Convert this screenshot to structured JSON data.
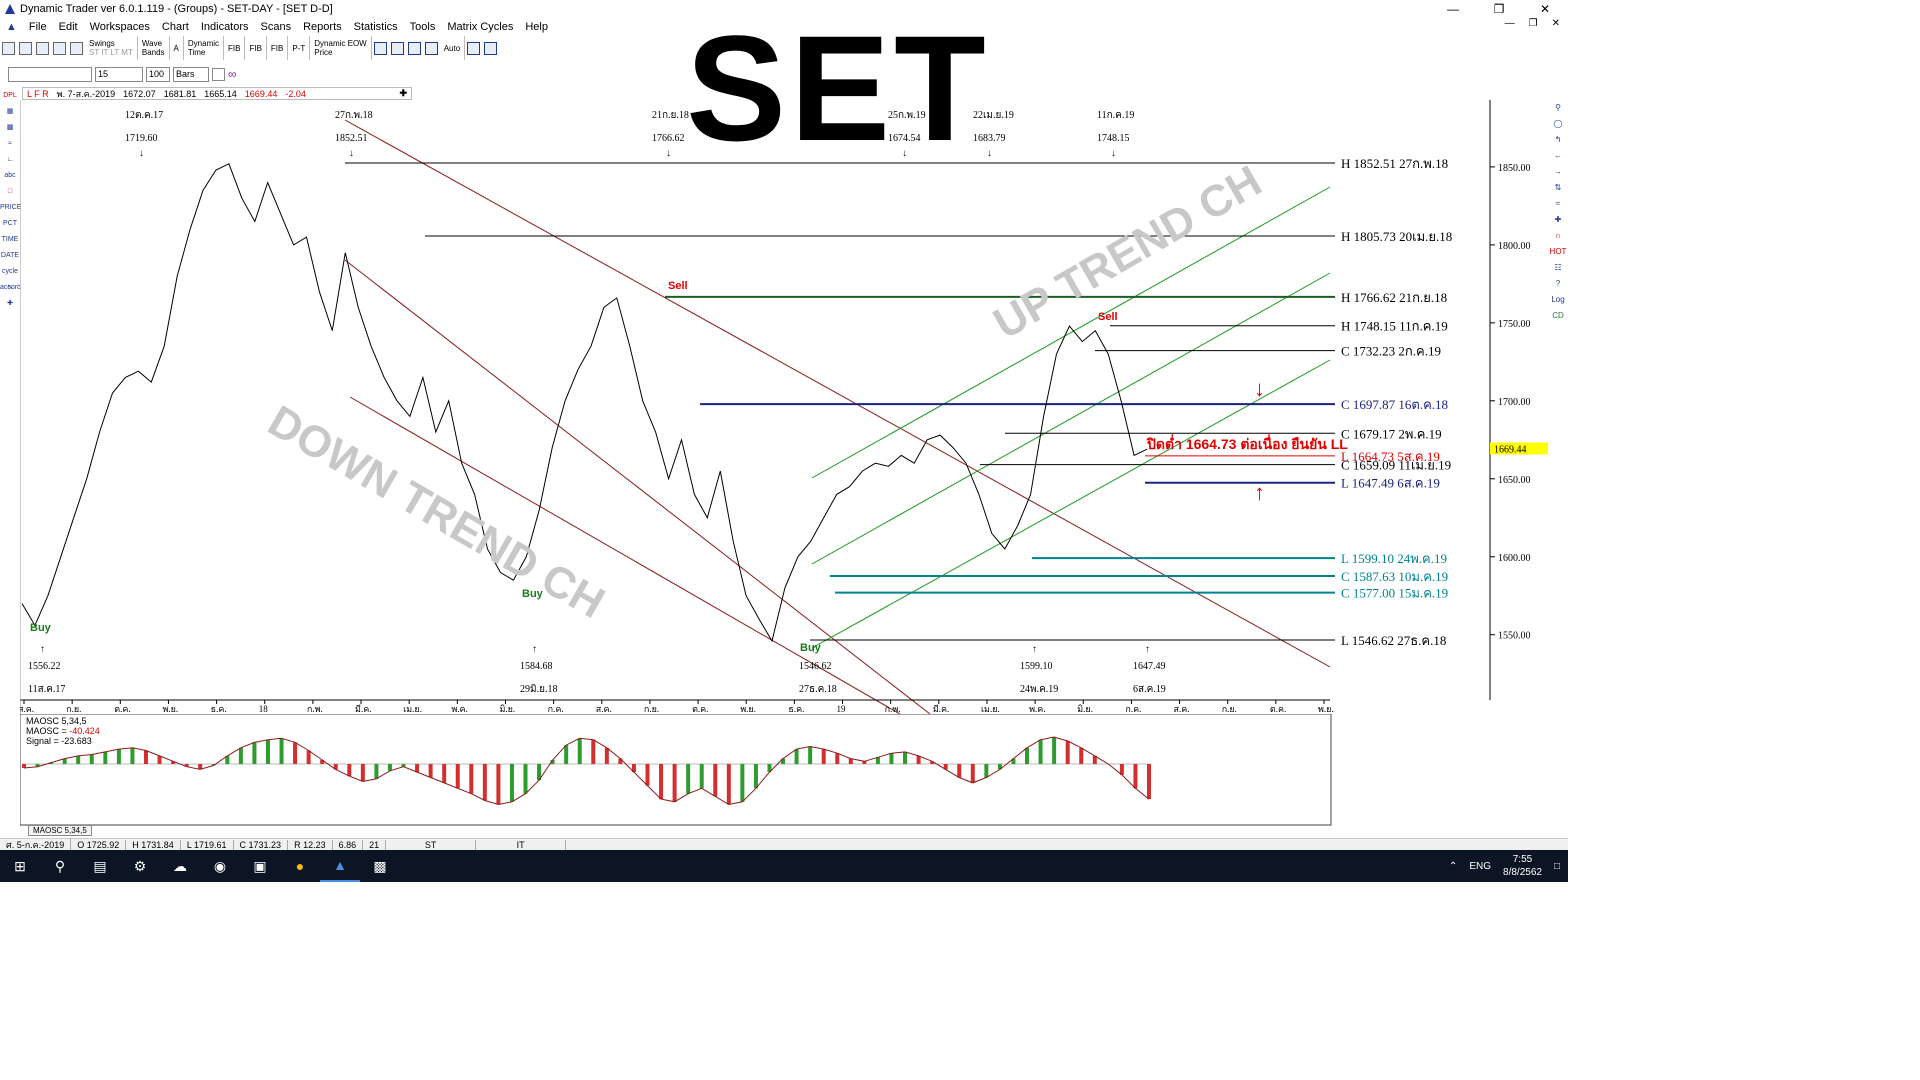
{
  "window": {
    "title": "Dynamic Trader ver 6.0.1.119 - (Groups) - SET-DAY - [SET D-D]",
    "min": "—",
    "max": "❐",
    "close": "✕"
  },
  "menu": [
    "File",
    "Edit",
    "Workspaces",
    "Chart",
    "Indicators",
    "Scans",
    "Reports",
    "Statistics",
    "Tools",
    "Matrix Cycles",
    "Help"
  ],
  "toolbar": {
    "swings": "Swings",
    "swing_sub1": "ST IT LT MT",
    "swing_sub2": "IT LT MT",
    "wave": "Wave",
    "bands": "Bands",
    "a_label": "A",
    "dyn_time1": "Dynamic",
    "dyn_time2": "Time",
    "fib1": "FIB",
    "fib2": "FIB",
    "fib3": "FIB",
    "pt": "P-T",
    "eow1": "Dynamic EOW",
    "eow2": "Price",
    "auto": "Auto"
  },
  "toolbar2": {
    "field1": "",
    "field2": "15",
    "field3": "100",
    "field4": "Bars"
  },
  "infobar": {
    "flags": "L F R",
    "date": "พ. 7-ส.ค.-2019",
    "open": "1672.07",
    "high": "1681.81",
    "low": "1665.14",
    "close": "1669.44",
    "change": "-2.04"
  },
  "lefttools": [
    "DPL",
    "",
    "",
    "",
    "",
    "abc",
    "",
    "PRICE",
    "PCT",
    "TIME",
    "DATE",
    "cycle accord",
    "",
    ""
  ],
  "righttools": [
    "",
    "",
    "",
    "",
    "",
    "",
    "",
    "",
    "",
    "HOT",
    "",
    "?",
    "Log",
    "CD"
  ],
  "title_overlay": "SET",
  "annotations": {
    "down_trend": "DOWN TREND CH",
    "up_trend": "UP TREND CH",
    "sell1": "Sell",
    "sell2": "Sell",
    "buy1": "Buy",
    "buy2": "Buy",
    "thai_note": "ปิดต่ำ 1664.73 ต่อเนื่อง ยืนยัน LL"
  },
  "top_pivots": [
    {
      "date": "12ต.ค.17",
      "price": "1719.60"
    },
    {
      "date": "27ก.พ.18",
      "price": "1852.51"
    },
    {
      "date": "21ก.ย.18",
      "price": "1766.62"
    },
    {
      "date": "25ก.พ.19",
      "price": "1674.54"
    },
    {
      "date": "22เม.ย.19",
      "price": "1683.79"
    },
    {
      "date": "11ก.ค.19",
      "price": "1748.15"
    }
  ],
  "bottom_pivots": [
    {
      "price": "1556.22",
      "date": "11ส.ค.17"
    },
    {
      "price": "1584.68",
      "date": "29มิ.ย.18"
    },
    {
      "price": "1546.62",
      "date": "27ธ.ค.18"
    },
    {
      "price": "1599.10",
      "date": "24พ.ค.19"
    },
    {
      "price": "1647.49",
      "date": "6ส.ค.19"
    }
  ],
  "levels": [
    {
      "label": "H 1852.51 27ก.พ.18",
      "value": 1852.51,
      "color": "#000000"
    },
    {
      "label": "H 1805.73 20เม.ย.18",
      "value": 1805.73,
      "color": "#000000"
    },
    {
      "label": "H 1766.62 21ก.ย.18",
      "value": 1766.62,
      "color": "#000000"
    },
    {
      "label": "H 1748.15 11ก.ค.19",
      "value": 1748.15,
      "color": "#000000"
    },
    {
      "label": "C 1732.23 2ก.ค.19",
      "value": 1732.23,
      "color": "#000000"
    },
    {
      "label": "C 1697.87 16ต.ค.18",
      "value": 1697.87,
      "color": "#1a237e"
    },
    {
      "label": "C 1679.17 2พ.ค.19",
      "value": 1679.17,
      "color": "#000000"
    },
    {
      "label": "L 1664.73 5ส.ค.19",
      "value": 1664.73,
      "color": "#e00000"
    },
    {
      "label": "C 1659.09 11เม.ย.19",
      "value": 1659.09,
      "color": "#000000"
    },
    {
      "label": "L 1647.49 6ส.ค.19",
      "value": 1647.49,
      "color": "#1a237e"
    },
    {
      "label": "L 1599.10 24พ.ค.19",
      "value": 1599.1,
      "color": "#00838f"
    },
    {
      "label": "C 1587.63 10ม.ค.19",
      "value": 1587.63,
      "color": "#00838f"
    },
    {
      "label": "C 1577.00 15ม.ค.19",
      "value": 1577.0,
      "color": "#00838f"
    },
    {
      "label": "L 1546.62 27ธ.ค.18",
      "value": 1546.62,
      "color": "#000000"
    }
  ],
  "y_ticks": [
    "1850.00",
    "1800.00",
    "1750.00",
    "1700.00",
    "1650.00",
    "1600.00",
    "1550.00"
  ],
  "last_price": "1669.44",
  "x_ticks": [
    "ส.ค.",
    "ก.ย.",
    "ต.ค.",
    "พ.ย.",
    "ธ.ค.",
    "18",
    "ก.พ.",
    "มี.ค.",
    "เม.ย.",
    "พ.ค.",
    "มิ.ย.",
    "ก.ค.",
    "ส.ค.",
    "ก.ย.",
    "ต.ค.",
    "พ.ย.",
    "ธ.ค.",
    "19",
    "ก.พ.",
    "มี.ค.",
    "เม.ย.",
    "พ.ค.",
    "มิ.ย.",
    "ก.ค.",
    "ส.ค.",
    "ก.ย.",
    "ต.ค.",
    "พ.ย."
  ],
  "osc": {
    "line1": "MAOSC 5,34,5",
    "line2_label": "MAOSC = ",
    "line2_value": "-40.424",
    "line3": "Signal = -23.683",
    "tab": "MAOSC 5,34,5"
  },
  "status": [
    "ศ. 5-ก.ค.-2019",
    "O 1725.92",
    "H 1731.84",
    "L 1719.61",
    "C 1731.23",
    "R 12.23",
    "6.86",
    "21",
    "ST",
    "IT"
  ],
  "taskbar": {
    "lang": "ENG",
    "time": "7:55",
    "date": "8/8/2562"
  },
  "chart_data": {
    "type": "line",
    "title": "SET",
    "y_range": [
      1530,
      1870
    ],
    "series": [
      {
        "values": [
          1570,
          1556,
          1575,
          1600,
          1625,
          1650,
          1680,
          1705,
          1715,
          1719,
          1712,
          1735,
          1780,
          1810,
          1835,
          1848,
          1852,
          1830,
          1815,
          1840,
          1820,
          1800,
          1805,
          1770,
          1745,
          1795,
          1760,
          1735,
          1715,
          1700,
          1690,
          1715,
          1680,
          1700,
          1660,
          1640,
          1605,
          1590,
          1585,
          1600,
          1630,
          1670,
          1700,
          1720,
          1735,
          1760,
          1766,
          1735,
          1700,
          1680,
          1650,
          1675,
          1640,
          1625,
          1655,
          1610,
          1575,
          1560,
          1546,
          1580,
          1600,
          1610,
          1625,
          1640,
          1645,
          1655,
          1660,
          1658,
          1665,
          1660,
          1675,
          1678,
          1670,
          1660,
          1640,
          1615,
          1605,
          1620,
          1640,
          1690,
          1730,
          1748,
          1738,
          1745,
          1730,
          1700,
          1665,
          1669
        ]
      }
    ],
    "osc": {
      "name": "MAOSC 5,34,5",
      "values": [
        -3,
        -2,
        1,
        4,
        6,
        7,
        9,
        11,
        12,
        10,
        6,
        2,
        -2,
        -4,
        -1,
        6,
        12,
        16,
        18,
        19,
        16,
        10,
        3,
        -4,
        -9,
        -13,
        -11,
        -5,
        -2,
        -6,
        -10,
        -14,
        -18,
        -22,
        -27,
        -30,
        -28,
        -22,
        -12,
        3,
        14,
        19,
        18,
        12,
        4,
        -6,
        -16,
        -26,
        -28,
        -22,
        -18,
        -24,
        -30,
        -28,
        -18,
        -6,
        4,
        11,
        13,
        11,
        8,
        4,
        2,
        5,
        8,
        9,
        6,
        2,
        -4,
        -10,
        -14,
        -10,
        -4,
        4,
        12,
        18,
        20,
        17,
        12,
        6,
        0,
        -8,
        -18,
        -26
      ]
    }
  }
}
